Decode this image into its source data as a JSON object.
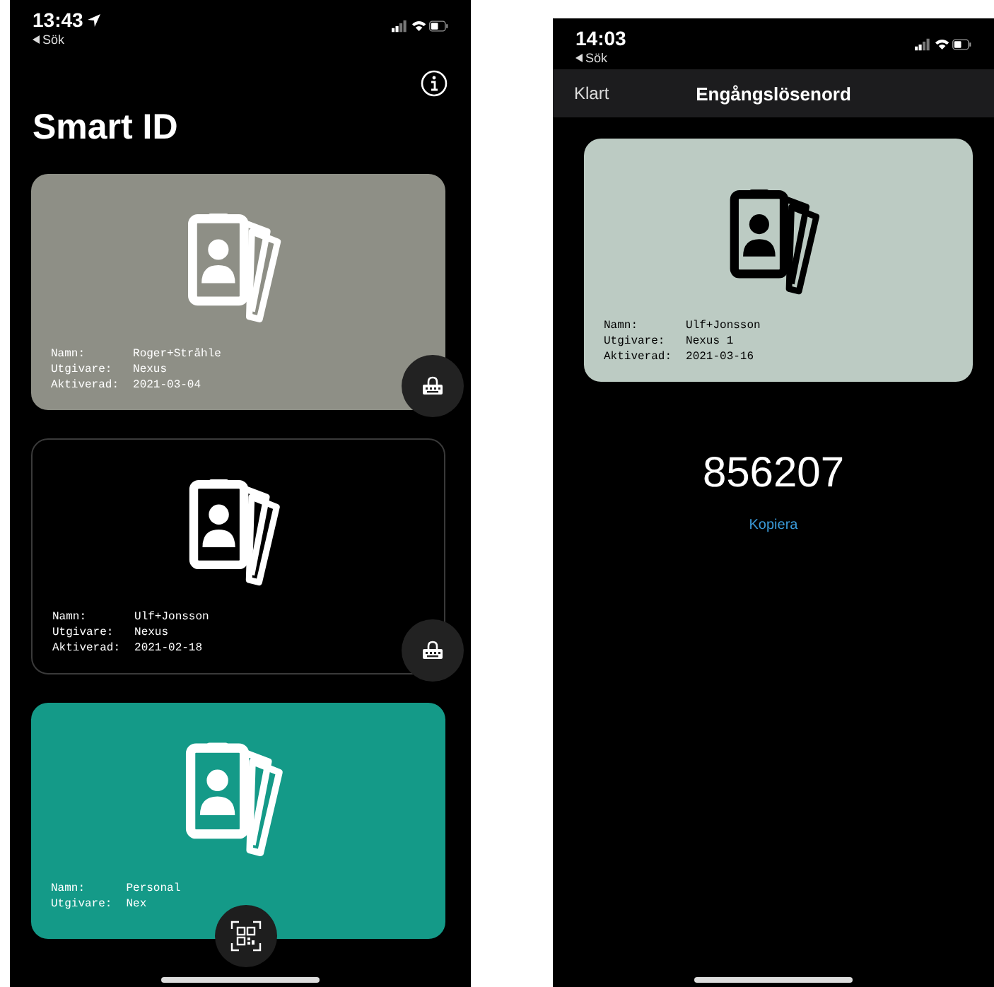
{
  "screens": [
    {
      "kind": "wallet",
      "status_bar": {
        "time": "13:43",
        "location": true,
        "back": "Sök"
      },
      "title": "Smart ID",
      "cards": [
        {
          "color": "#8e8f86",
          "lock_button": true,
          "fields": [
            {
              "label": "Namn:",
              "value": "Roger+Stråhle"
            },
            {
              "label": "Utgivare:",
              "value": "Nexus"
            },
            {
              "label": "Aktiverad:",
              "value": "2021-03-04"
            }
          ]
        },
        {
          "color": "#000000",
          "lock_button": true,
          "fields": [
            {
              "label": "Namn:",
              "value": "Ulf+Jonsson"
            },
            {
              "label": "Utgivare:",
              "value": "Nexus"
            },
            {
              "label": "Aktiverad:",
              "value": "2021-02-18"
            }
          ]
        },
        {
          "color": "#149a88",
          "lock_button": false,
          "fields": [
            {
              "label": "Namn:",
              "value": "Personal"
            },
            {
              "label": "Utgivare:",
              "value": "Nex"
            }
          ]
        }
      ]
    },
    {
      "kind": "otp",
      "status_bar": {
        "time": "14:03",
        "back": "Sök"
      },
      "nav": {
        "left": "Klart",
        "title": "Engångslösenord"
      },
      "card": {
        "color": "#bccbc3",
        "fields": [
          {
            "label": "Namn:",
            "value": "Ulf+Jonsson"
          },
          {
            "label": "Utgivare:",
            "value": "Nexus 1"
          },
          {
            "label": "Aktiverad:",
            "value": "2021-03-16"
          }
        ]
      },
      "code": "856207",
      "copy": "Kopiera"
    }
  ]
}
